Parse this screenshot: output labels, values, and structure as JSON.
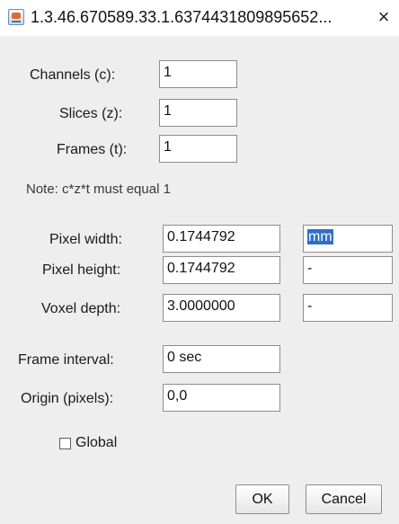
{
  "window": {
    "title": "1.3.46.670589.33.1.6374431809895652...",
    "close_glyph": "×",
    "app_icon": "java-app-icon"
  },
  "dimensions": {
    "channels": {
      "label": "Channels (c):",
      "value": "1"
    },
    "slices": {
      "label": "Slices (z):",
      "value": "1"
    },
    "frames": {
      "label": "Frames (t):",
      "value": "1"
    },
    "note": "Note: c*z*t must equal 1"
  },
  "calibration": {
    "pixel_width": {
      "label": "Pixel width:",
      "value": "0.1744792",
      "unit": "mm",
      "unit_selected": true
    },
    "pixel_height": {
      "label": "Pixel height:",
      "value": "0.1744792",
      "unit": "-"
    },
    "voxel_depth": {
      "label": "Voxel depth:",
      "value": "3.0000000",
      "unit": "-"
    }
  },
  "timing": {
    "frame_interval": {
      "label": "Frame interval:",
      "value": "0 sec"
    },
    "origin": {
      "label": "Origin (pixels):",
      "value": "0,0"
    }
  },
  "global": {
    "label": "Global",
    "checked": false
  },
  "buttons": {
    "ok": "OK",
    "cancel": "Cancel"
  }
}
